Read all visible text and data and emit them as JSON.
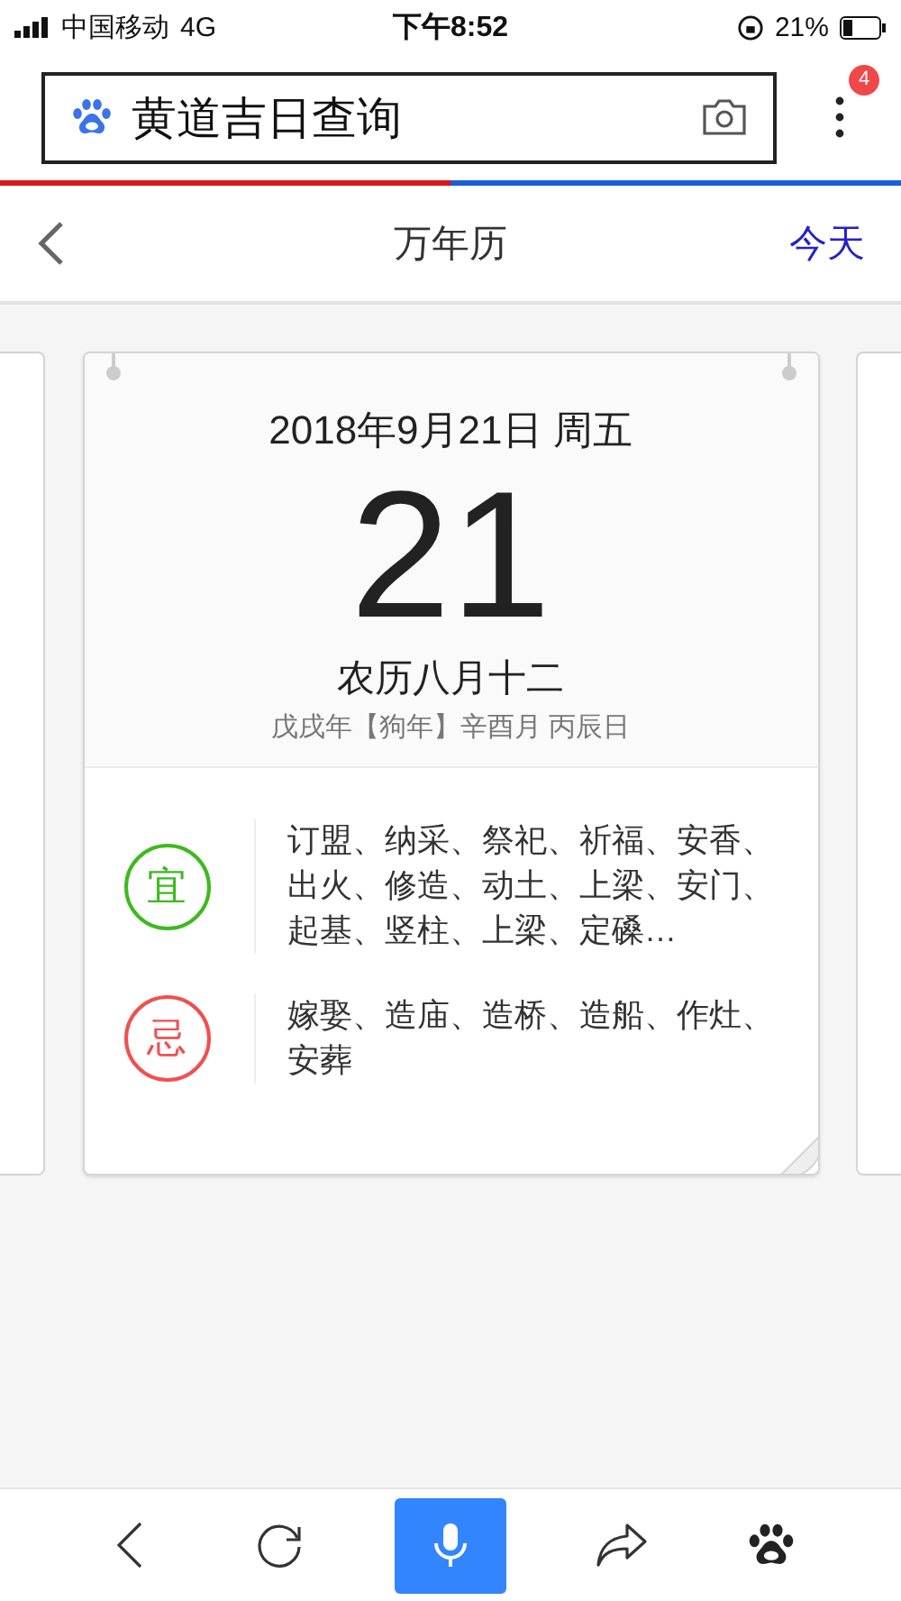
{
  "status_bar": {
    "carrier": "中国移动",
    "network": "4G",
    "time": "下午8:52",
    "battery": "21%"
  },
  "search": {
    "value": "黄道吉日查询",
    "badge": "4"
  },
  "load_progress": {
    "level": 0.5
  },
  "nav": {
    "title": "万年历",
    "today": "今天"
  },
  "card": {
    "date": "2018年9月21日 周五",
    "day": "21",
    "lunar": "农历八月十二",
    "ganzhi": "戊戌年【狗年】辛酉月 丙辰日"
  },
  "advice": [
    {
      "label": "宜",
      "color": "#3cba1e",
      "text": "订盟、纳采、祭祀、祈福、安香、出火、修造、动土、上梁、安门、起基、竖柱、上梁、定磉…"
    },
    {
      "label": "忌",
      "color": "#f05050",
      "text": "嫁娶、造庙、造桥、造船、作灶、安葬"
    }
  ]
}
